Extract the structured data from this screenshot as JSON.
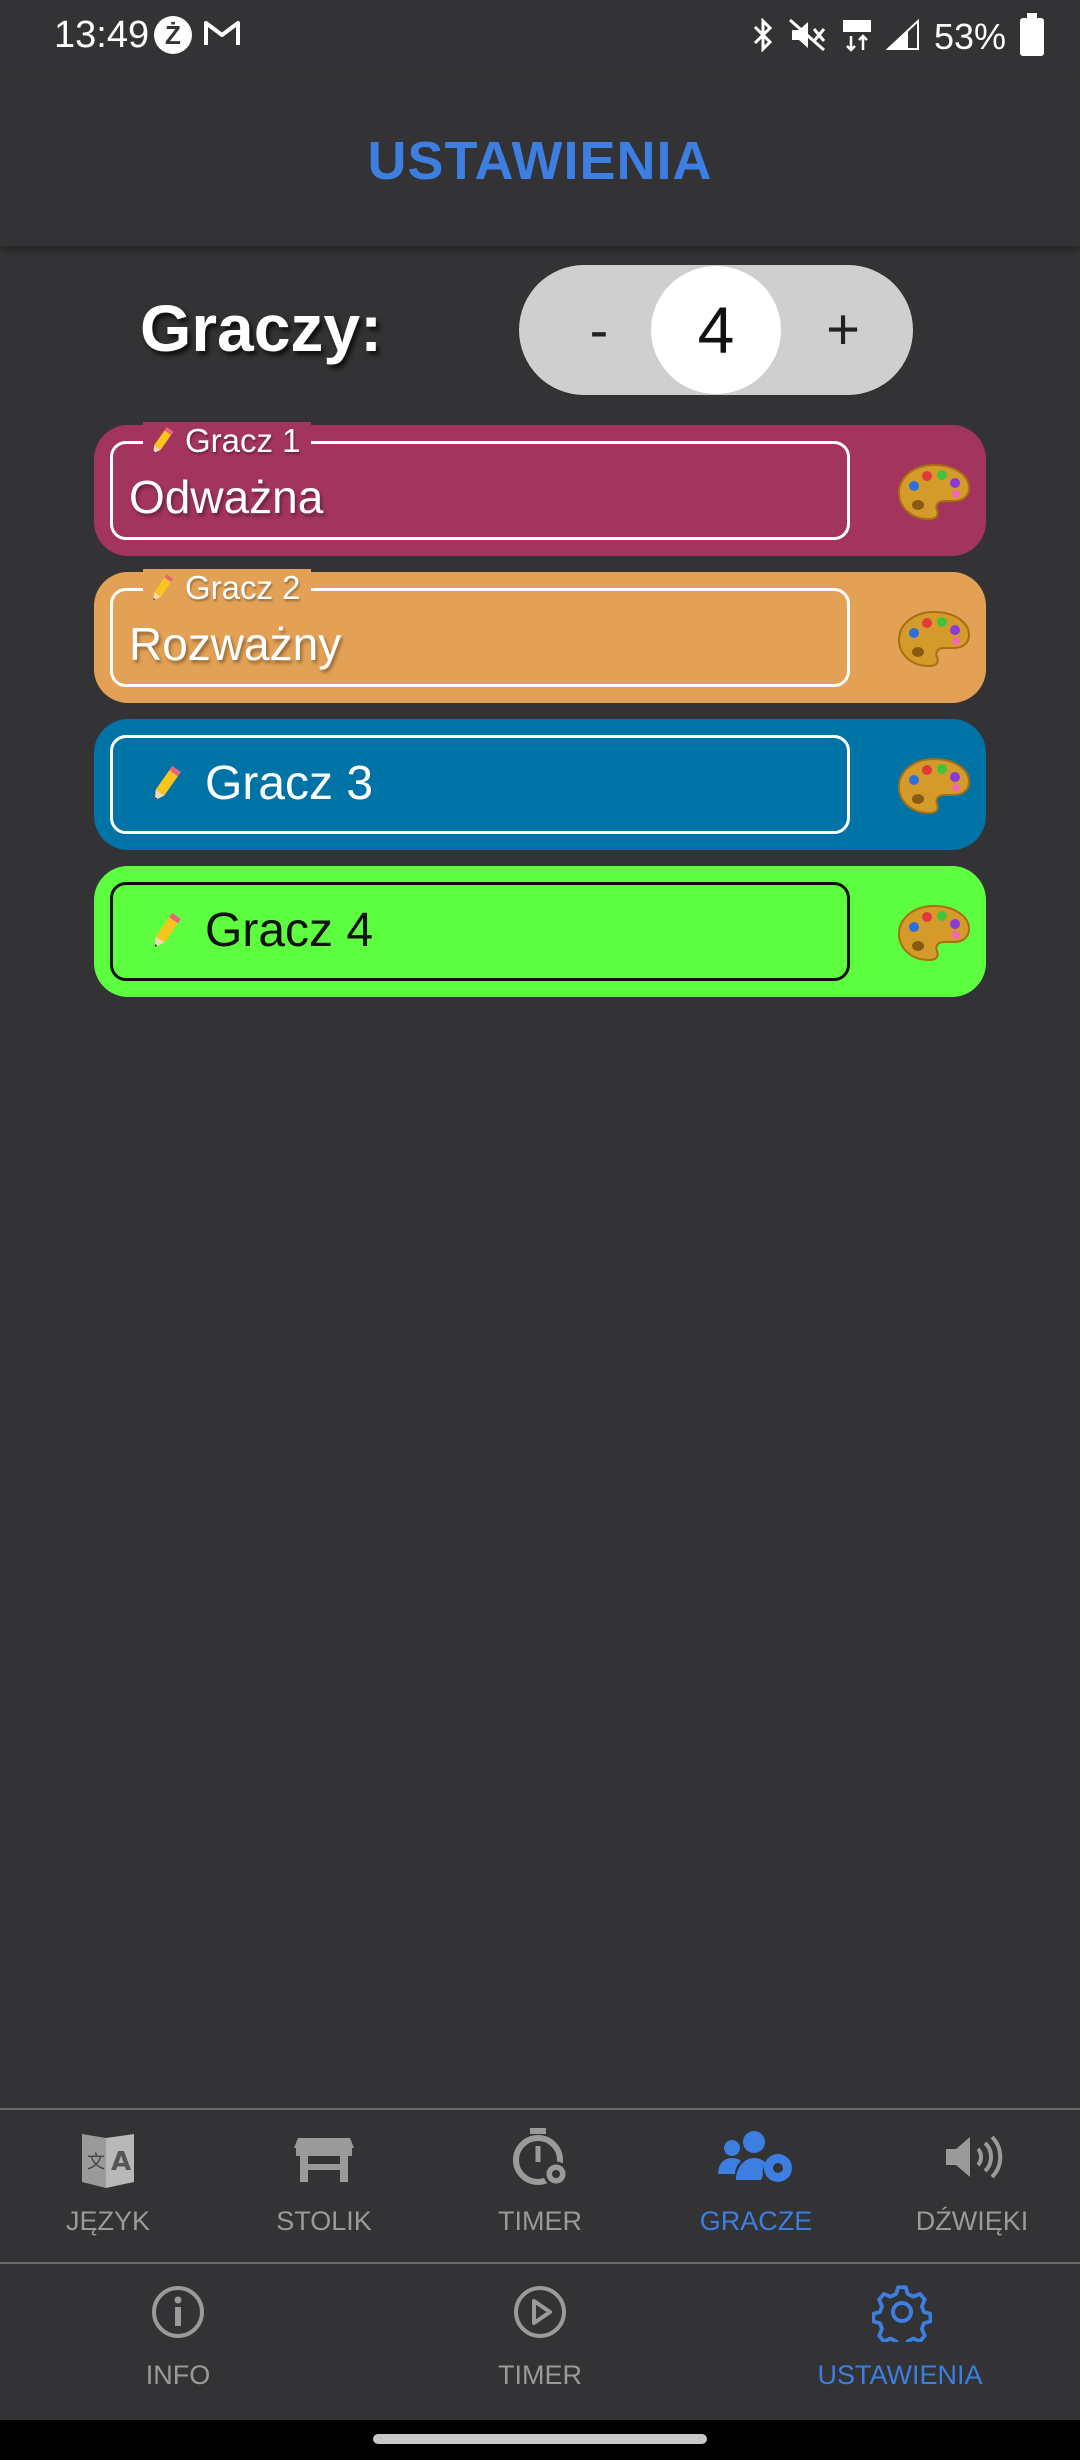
{
  "status_bar": {
    "time": "13:49",
    "badge_letter": "Ż",
    "battery": "53%"
  },
  "header": {
    "title": "USTAWIENIA"
  },
  "players_count": {
    "label": "Graczy:",
    "minus": "-",
    "plus": "+",
    "value": "4"
  },
  "players": [
    {
      "label": "Gracz 1",
      "value": "Odważna",
      "color": "#a2345e"
    },
    {
      "label": "Gracz 2",
      "value": "Rozważny",
      "color": "#e3a156"
    },
    {
      "label": "Gracz 3",
      "value": "",
      "color": "#0073a6"
    },
    {
      "label": "Gracz 4",
      "value": "",
      "color": "#5dfd40"
    }
  ],
  "sub_nav": {
    "items": [
      {
        "label": "JĘZYK",
        "icon": "language-icon",
        "active": false
      },
      {
        "label": "STOLIK",
        "icon": "table-icon",
        "active": false
      },
      {
        "label": "TIMER",
        "icon": "stopwatch-gear-icon",
        "active": false
      },
      {
        "label": "GRACZE",
        "icon": "users-gear-icon",
        "active": true
      },
      {
        "label": "DŹWIĘKI",
        "icon": "speaker-icon",
        "active": false
      }
    ]
  },
  "main_nav": {
    "items": [
      {
        "label": "INFO",
        "icon": "info-icon",
        "active": false
      },
      {
        "label": "TIMER",
        "icon": "play-icon",
        "active": false
      },
      {
        "label": "USTAWIENIA",
        "icon": "gear-icon",
        "active": true
      }
    ]
  },
  "colors": {
    "accent": "#3d7fe0",
    "inactive": "#9a9a9a",
    "background": "#333234"
  }
}
